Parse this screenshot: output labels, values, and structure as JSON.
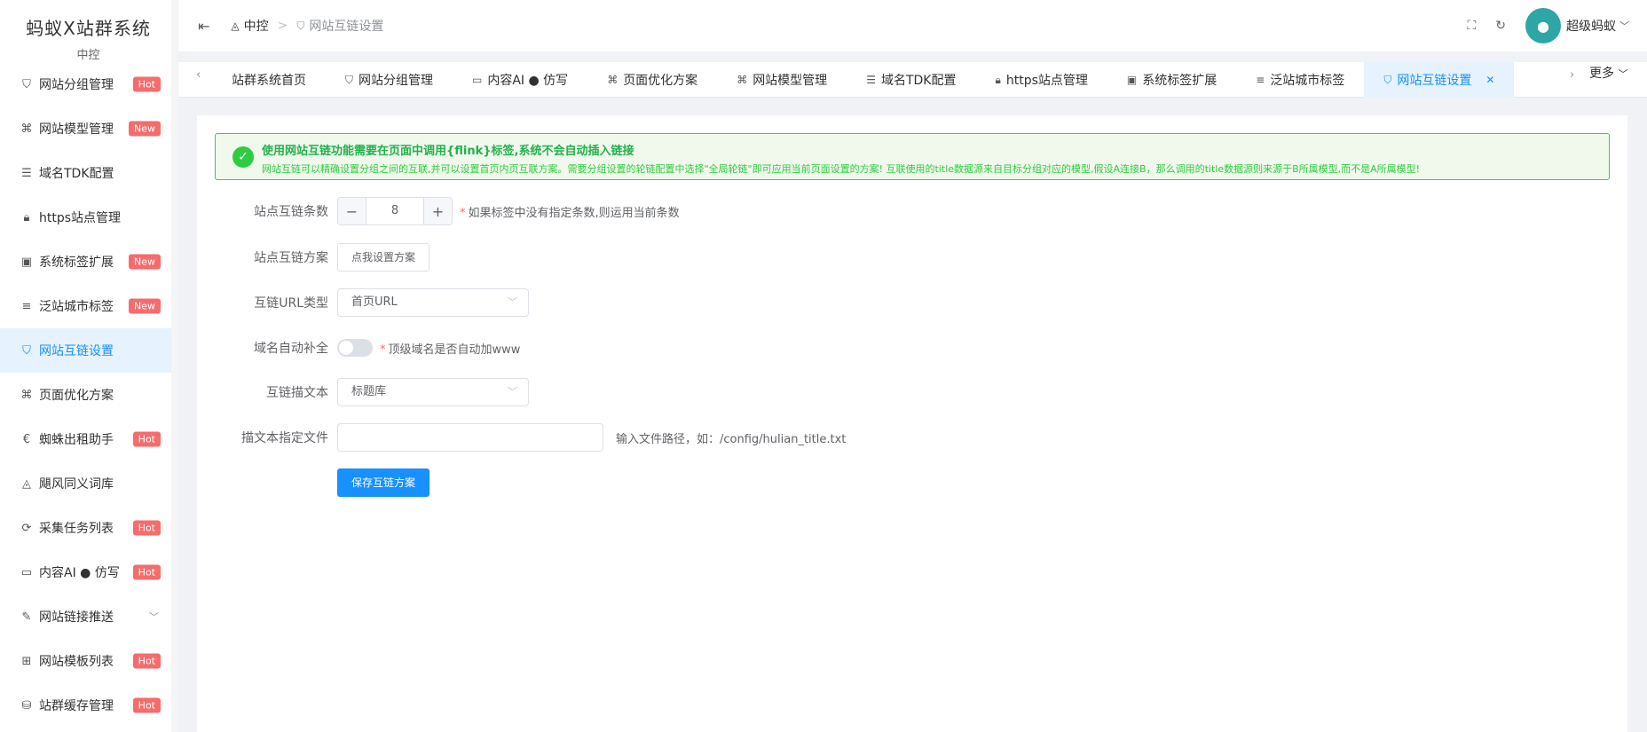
{
  "app": {
    "title": "蚂蚁X站群系统",
    "subtitle": "中控"
  },
  "sidebar": {
    "items": [
      {
        "label": "网站分组管理",
        "icon": "shield-check-icon",
        "glyph": "⛉",
        "badge": "Hot",
        "badge_color": "#f56c6c"
      },
      {
        "label": "网站模型管理",
        "icon": "apps-icon",
        "glyph": "⌘",
        "badge": "New",
        "badge_color": "#f56c6c"
      },
      {
        "label": "域名TDK配置",
        "icon": "list-icon",
        "glyph": "☰",
        "badge": "",
        "badge_color": ""
      },
      {
        "label": "https站点管理",
        "icon": "lock-icon",
        "glyph": "🔒︎",
        "badge": "",
        "badge_color": ""
      },
      {
        "label": "系统标签扩展",
        "icon": "tag-box-icon",
        "glyph": "▣",
        "badge": "New",
        "badge_color": "#f56c6c"
      },
      {
        "label": "泛站城市标签",
        "icon": "menu-lines-icon",
        "glyph": "≡",
        "badge": "New",
        "badge_color": "#f56c6c"
      },
      {
        "label": "网站互链设置",
        "icon": "shield-check-icon",
        "glyph": "⛉",
        "badge": "",
        "badge_color": "",
        "active": true
      },
      {
        "label": "页面优化方案",
        "icon": "apps-icon",
        "glyph": "⌘",
        "badge": "",
        "badge_color": ""
      },
      {
        "label": "蜘蛛出租助手",
        "icon": "coin-icon",
        "glyph": "€",
        "badge": "Hot",
        "badge_color": "#f56c6c"
      },
      {
        "label": "飓风同义词库",
        "icon": "compass-icon",
        "glyph": "◬",
        "badge": "",
        "badge_color": ""
      },
      {
        "label": "采集任务列表",
        "icon": "sync-icon",
        "glyph": "⟳",
        "badge": "Hot",
        "badge_color": "#f56c6c"
      },
      {
        "label": "内容AI ● 仿写",
        "icon": "monitor-icon",
        "glyph": "▭",
        "badge": "Hot",
        "badge_color": "#f56c6c"
      },
      {
        "label": "网站链接推送",
        "icon": "pin-icon",
        "glyph": "✎",
        "badge": "",
        "badge_color": "",
        "arrow": "﹀"
      },
      {
        "label": "网站模板列表",
        "icon": "grid-icon",
        "glyph": "⊞",
        "badge": "Hot",
        "badge_color": "#f56c6c"
      },
      {
        "label": "站群缓存管理",
        "icon": "database-icon",
        "glyph": "⛁",
        "badge": "Hot",
        "badge_color": "#f56c6c"
      }
    ]
  },
  "header": {
    "breadcrumb_home": "中控",
    "breadcrumb_sep": ">",
    "breadcrumb_current": "网站互链设置",
    "user_name": "超级蚂蚁"
  },
  "tabs": {
    "items": [
      {
        "label": "站群系统首页",
        "icon": "",
        "glyph": ""
      },
      {
        "label": "网站分组管理",
        "icon": "shield-check-icon",
        "glyph": "⛉"
      },
      {
        "label": "内容AI ● 仿写",
        "icon": "monitor-icon",
        "glyph": "▭"
      },
      {
        "label": "页面优化方案",
        "icon": "apps-icon",
        "glyph": "⌘"
      },
      {
        "label": "网站模型管理",
        "icon": "apps-icon",
        "glyph": "⌘"
      },
      {
        "label": "域名TDK配置",
        "icon": "list-icon",
        "glyph": "☰"
      },
      {
        "label": "https站点管理",
        "icon": "lock-icon",
        "glyph": "🔒︎"
      },
      {
        "label": "系统标签扩展",
        "icon": "tag-box-icon",
        "glyph": "▣"
      },
      {
        "label": "泛站城市标签",
        "icon": "menu-lines-icon",
        "glyph": "≡"
      },
      {
        "label": "网站互链设置",
        "icon": "shield-check-icon",
        "glyph": "⛉",
        "active": true
      }
    ],
    "more_label": "更多"
  },
  "alert": {
    "title": "使用网站互链功能需要在页面中调用{flink}标签,系统不会自动插入链接",
    "desc": "网站互链可以精确设置分组之间的互联,并可以设置首页内页互联方案。需要分组设置的轮链配置中选择\"全局轮链\"即可应用当前页面设置的方案! 互联使用的title数据源来自目标分组对应的模型,假设A连接B，那么调用的title数据源则来源于B所属模型,而不是A所属模型!"
  },
  "form": {
    "link_count_label": "站点互链条数",
    "link_count_value": "8",
    "link_count_hint": "如果标签中没有指定条数,则运用当前条数",
    "scheme_label": "站点互链方案",
    "scheme_button": "点我设置方案",
    "url_type_label": "互链URL类型",
    "url_type_value": "首页URL",
    "auto_domain_label": "域名自动补全",
    "auto_domain_hint": "顶级域名是否自动加www",
    "anchor_label": "互链描文本",
    "anchor_value": "标题库",
    "anchor_file_label": "描文本指定文件",
    "anchor_file_value": "",
    "anchor_file_hint": "输入文件路径，如：/config/hulian_title.txt",
    "save_button": "保存互链方案"
  }
}
